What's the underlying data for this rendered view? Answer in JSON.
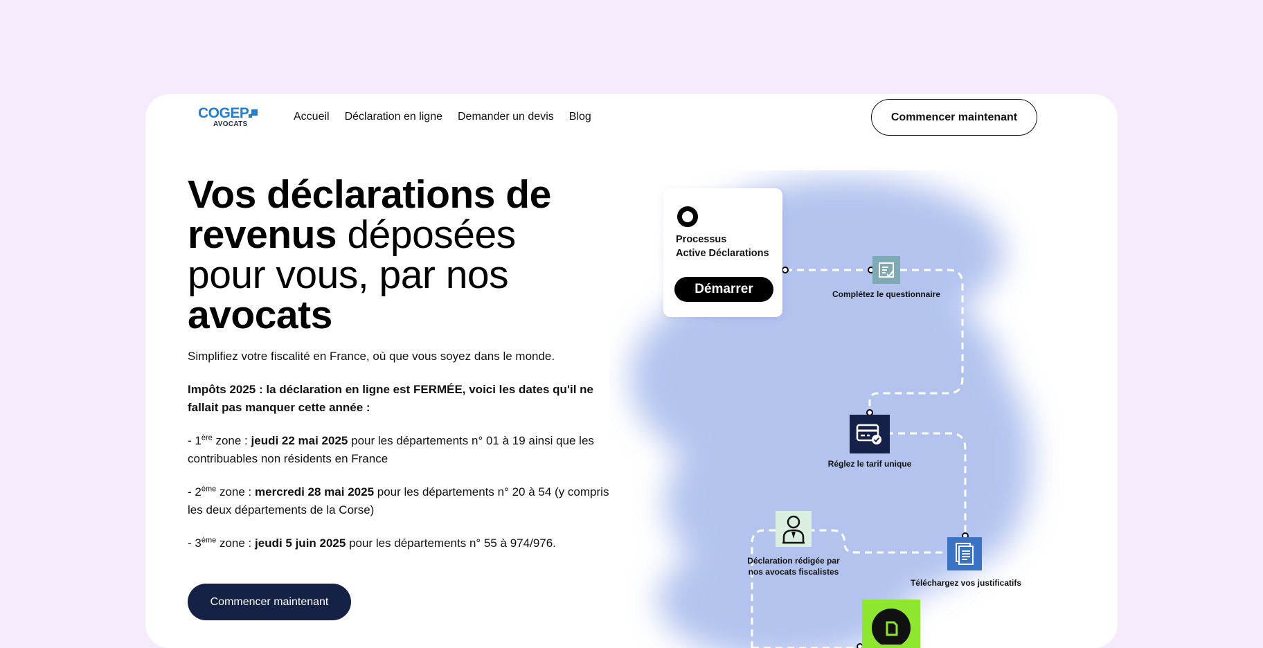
{
  "header": {
    "logo": {
      "brand": "COGEP",
      "sub": "AVOCATS"
    },
    "nav": [
      "Accueil",
      "Déclaration en ligne",
      "Demander un devis",
      "Blog"
    ],
    "cta": "Commencer maintenant"
  },
  "hero": {
    "title_parts": [
      {
        "text": "Vos déclarations de",
        "bold": true
      },
      {
        "text": "revenus",
        "bold": true
      },
      {
        "text": " déposées",
        "bold": false
      },
      {
        "text": "pour vous, par nos",
        "bold": false
      },
      {
        "text": "avocats",
        "bold": true
      }
    ],
    "lead": "Simplifiez votre fiscalité en France, où que vous soyez dans le monde.",
    "alert": "Impôts 2025 : la déclaration en ligne est FERMÉE, voici les dates qu'il ne fallait pas manquer cette année :",
    "zones": [
      {
        "prefix": "- 1",
        "sup": "ère",
        "mid": " zone : ",
        "date": "jeudi 22 mai 2025",
        "rest": " pour les départements n° 01 à 19 ainsi que les contribuables non résidents en France"
      },
      {
        "prefix": "- 2",
        "sup": "ème",
        "mid": " zone : ",
        "date": "mercredi 28 mai 2025",
        "rest": " pour les départements n° 20 à 54 (y compris les deux départements de la Corse)"
      },
      {
        "prefix": "- 3",
        "sup": "ème",
        "mid": " zone : ",
        "date": "jeudi 5 juin 2025",
        "rest": " pour les départements n° 55 à 974/976."
      }
    ],
    "cta": "Commencer maintenant"
  },
  "illustration": {
    "card_title_1": "Processus",
    "card_title_2": "Active Déclarations",
    "card_button": "Démarrer",
    "steps": {
      "questionnaire": "Complétez le questionnaire",
      "tarif": "Réglez le tarif unique",
      "redaction_1": "Déclaration rédigée par",
      "redaction_2": "nos avocats fiscalistes",
      "justificatifs": "Téléchargez vos justificatifs"
    },
    "colors": {
      "cloud": "#9db2ea",
      "navy": "#16214a",
      "teal": "#7fa9b5",
      "blue": "#3a73c4",
      "green": "#8fe62e"
    }
  }
}
